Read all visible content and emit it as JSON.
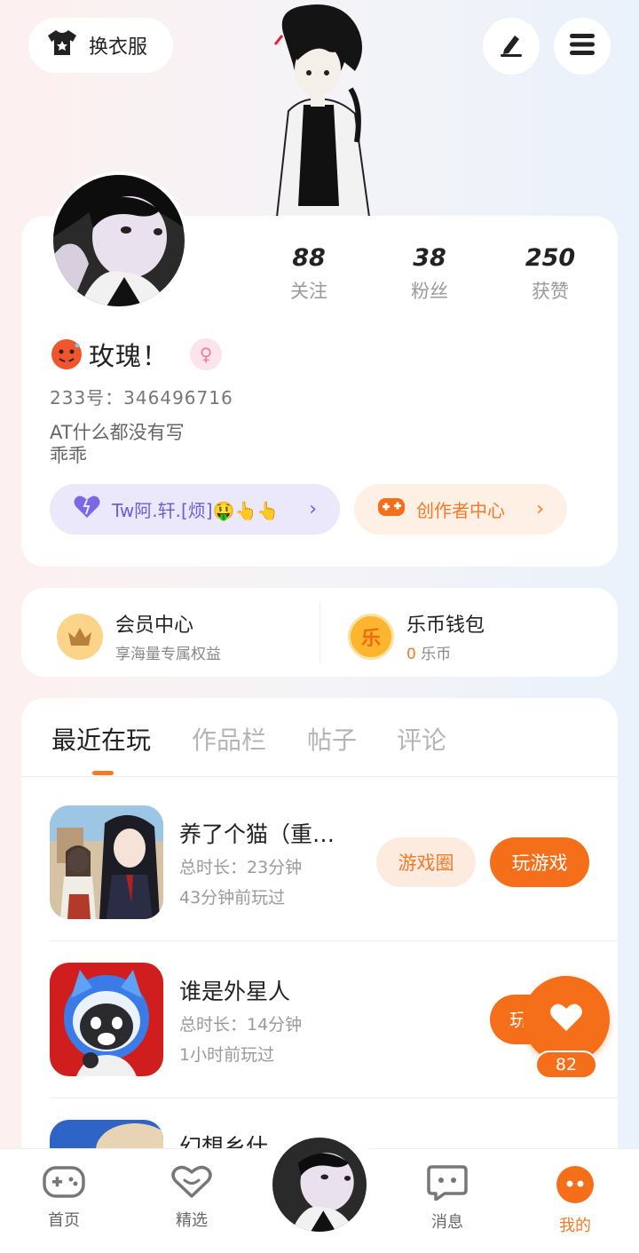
{
  "top": {
    "outfit_label": "换衣服"
  },
  "profile": {
    "stats": [
      {
        "value": "88",
        "label": "关注"
      },
      {
        "value": "38",
        "label": "粉丝"
      },
      {
        "value": "250",
        "label": "获赞"
      }
    ],
    "username": "玫瑰！",
    "uid": "233号：346496716",
    "bio_line1": "AT什么都没有写",
    "bio_line2": "乖乖",
    "fan_pill": "Tw阿.轩.[烦]🤑👆👆",
    "creator_pill": "创作者中心",
    "colors": {
      "accent": "#f47a2a",
      "fan": "#6c5fd8",
      "gender": "#f07ca5"
    }
  },
  "member": {
    "title": "会员中心",
    "subtitle": "享海量专属权益"
  },
  "wallet": {
    "title": "乐币钱包",
    "balance": "0",
    "unit": "乐币",
    "icon_char": "乐"
  },
  "tabs": [
    "最近在玩",
    "作品栏",
    "帖子",
    "评论"
  ],
  "games": [
    {
      "name": "养了个猫（重…",
      "duration": "总时长：23分钟",
      "last_played": "43分钟前玩过",
      "circle_label": "游戏圈",
      "play_label": "玩游戏"
    },
    {
      "name": "谁是外星人",
      "duration": "总时长：14分钟",
      "last_played": "1小时前玩过",
      "play_label": "玩"
    },
    {
      "name": "幻想乡什"
    }
  ],
  "like": {
    "count": "82"
  },
  "nav": [
    {
      "label": "首页"
    },
    {
      "label": "精选"
    },
    {
      "label": "消息"
    },
    {
      "label": "我的"
    }
  ]
}
